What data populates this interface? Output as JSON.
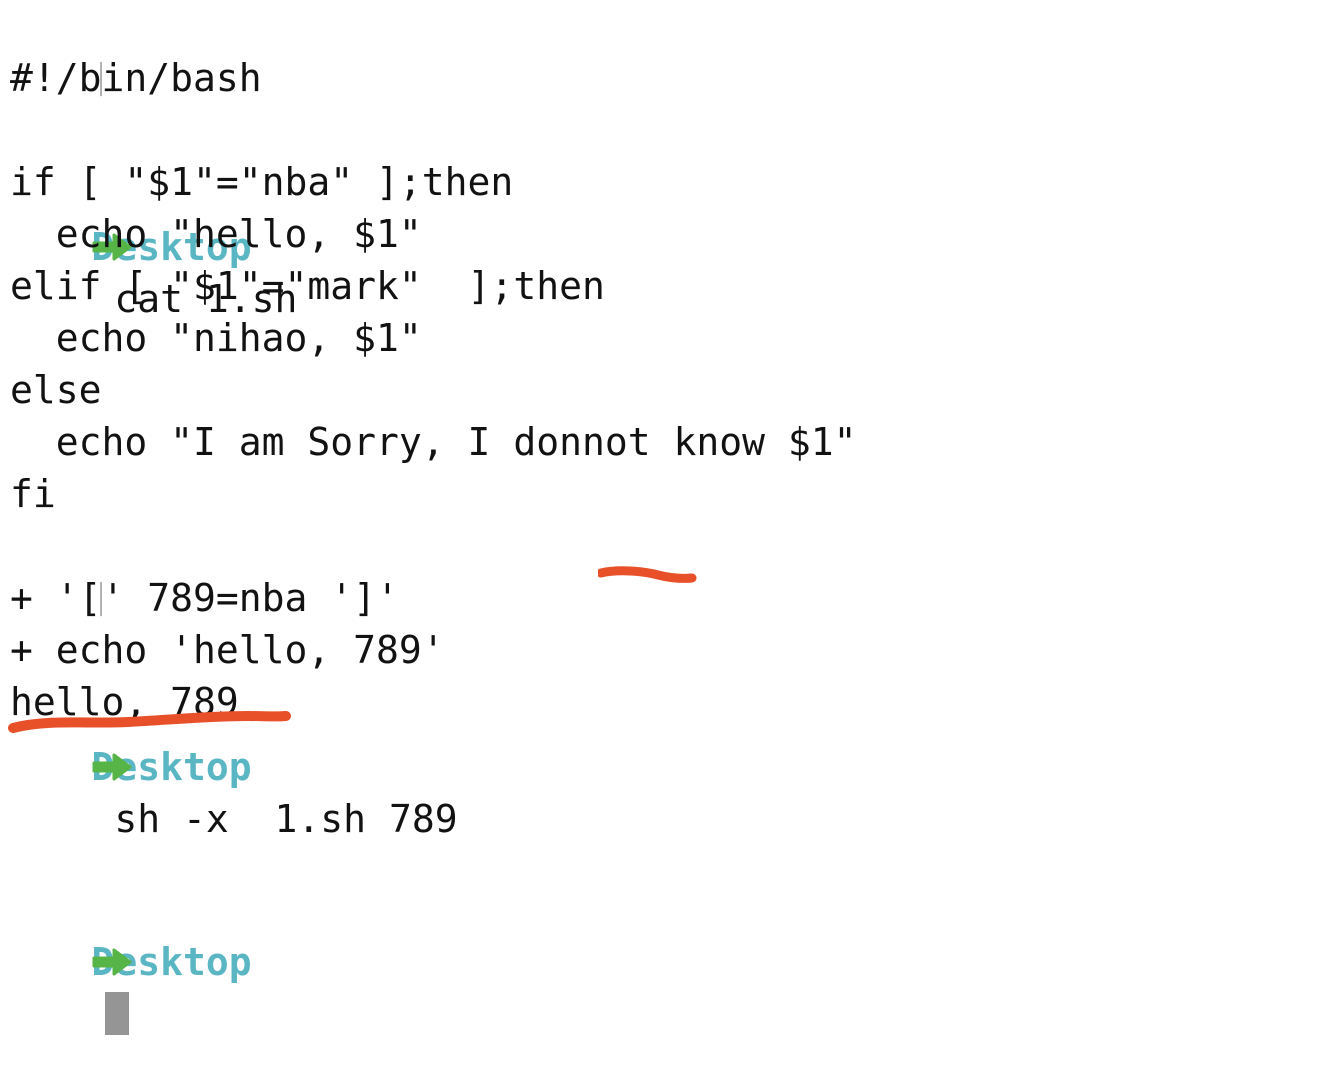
{
  "terminal": {
    "background_color": "#ffffff",
    "foreground_color": "#121212",
    "prompt_cwd_color": "#5bb6c4",
    "prompt_arrow_color": "#57b447",
    "annotation_color": "#e8502a",
    "cursor_color": "#959595",
    "prompt": {
      "bracket_stub": "[",
      "arrow_icon": "right-arrow-icon",
      "cwd": "Desktop"
    },
    "lines": [
      {
        "kind": "prompt",
        "cwd": "Desktop",
        "command": "cat 1.sh"
      },
      {
        "kind": "output",
        "text": "#!/bin/bash"
      },
      {
        "kind": "blank",
        "text": ""
      },
      {
        "kind": "output",
        "text": "if [ \"$1\"=\"nba\" ];then"
      },
      {
        "kind": "output",
        "text": "  echo \"hello, $1\""
      },
      {
        "kind": "output",
        "text": "elif [ \"$1\"=\"mark\"  ];then"
      },
      {
        "kind": "output",
        "text": "  echo \"nihao, $1\""
      },
      {
        "kind": "output",
        "text": "else"
      },
      {
        "kind": "output",
        "text": "  echo \"I am Sorry, I donnot know $1\""
      },
      {
        "kind": "output",
        "text": "fi"
      },
      {
        "kind": "prompt",
        "cwd": "Desktop",
        "command": "sh -x  1.sh 789"
      },
      {
        "kind": "output",
        "text": "+ '[' 789=nba ']'"
      },
      {
        "kind": "output",
        "text": "+ echo 'hello, 789'"
      },
      {
        "kind": "output",
        "text": "hello, 789"
      },
      {
        "kind": "prompt-cursor",
        "cwd": "Desktop",
        "command": ""
      }
    ],
    "annotations": [
      {
        "name": "underline-789-cmd",
        "underlines_text": "789",
        "color": "#e8502a"
      },
      {
        "name": "underline-hello-output",
        "underlines_text": "hello, 789",
        "color": "#e8502a"
      }
    ]
  }
}
